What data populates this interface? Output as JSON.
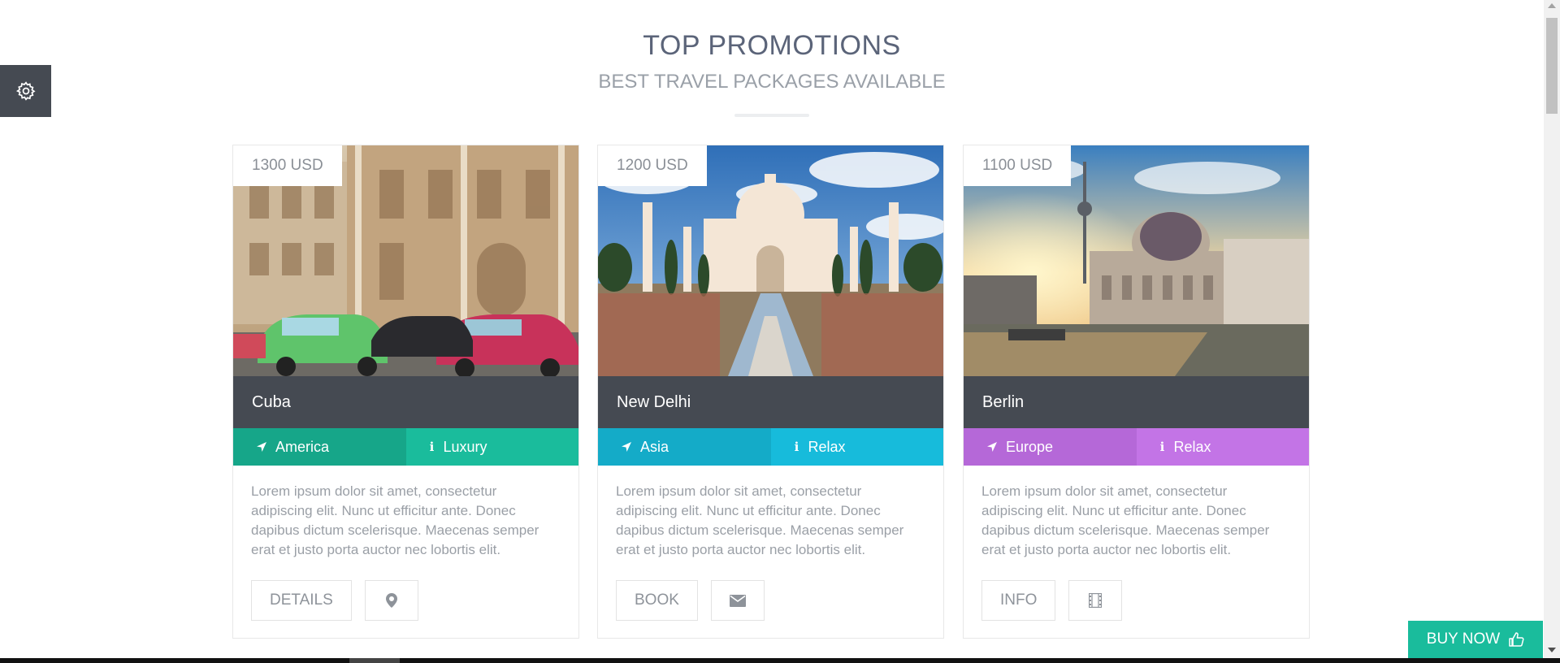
{
  "section": {
    "title": "TOP PROMOTIONS",
    "subtitle": "BEST TRAVEL PACKAGES AVAILABLE"
  },
  "cards": [
    {
      "price": "1300 USD",
      "title": "Cuba",
      "tags": [
        {
          "label": "America",
          "icon": "location-arrow-icon",
          "color": "#16a689"
        },
        {
          "label": "Luxury",
          "icon": "info-icon",
          "color": "#1abc9c"
        }
      ],
      "description": "Lorem ipsum dolor sit amet, consectetur adipiscing elit. Nunc ut efficitur ante. Donec dapibus dictum scelerisque. Maecenas semper erat et justo porta auctor nec lobortis elit.",
      "action_label": "DETAILS",
      "action_icon": "map-marker-icon"
    },
    {
      "price": "1200 USD",
      "title": "New Delhi",
      "tags": [
        {
          "label": "Asia",
          "icon": "location-arrow-icon",
          "color": "#14abc8"
        },
        {
          "label": "Relax",
          "icon": "info-icon",
          "color": "#17bbdb"
        }
      ],
      "description": "Lorem ipsum dolor sit amet, consectetur adipiscing elit. Nunc ut efficitur ante. Donec dapibus dictum scelerisque. Maecenas semper erat et justo porta auctor nec lobortis elit.",
      "action_label": "BOOK",
      "action_icon": "envelope-icon"
    },
    {
      "price": "1100 USD",
      "title": "Berlin",
      "tags": [
        {
          "label": "Europe",
          "icon": "location-arrow-icon",
          "color": "#b568d8"
        },
        {
          "label": "Relax",
          "icon": "info-icon",
          "color": "#c374e6"
        }
      ],
      "description": "Lorem ipsum dolor sit amet, consectetur adipiscing elit. Nunc ut efficitur ante. Donec dapibus dictum scelerisque. Maecenas semper erat et justo porta auctor nec lobortis elit.",
      "action_label": "INFO",
      "action_icon": "film-icon"
    }
  ],
  "buy_now": {
    "label": "BUY NOW",
    "icon": "thumbs-up-icon",
    "color": "#1abc9c"
  },
  "settings": {
    "icon": "gear-icon"
  }
}
